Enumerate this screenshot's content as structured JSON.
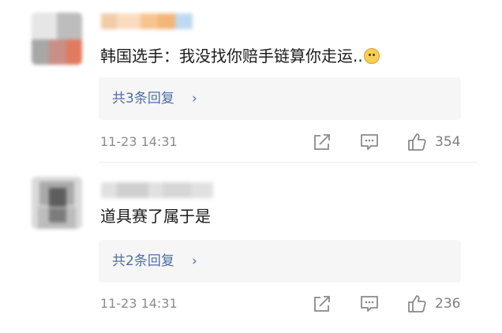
{
  "comments": [
    {
      "text": "韩国选手：我没找你赔手链算你走运..",
      "emoji": "smirk-cat-emoji",
      "replies_label": "共3条回复",
      "chevron": "›",
      "time": "11-23 14:31",
      "likes": "354"
    },
    {
      "text": "道具赛了属于是",
      "replies_label": "共2条回复",
      "chevron": "›",
      "time": "11-23 14:31",
      "likes": "236"
    }
  ],
  "colors": {
    "link": "#4f6ea6",
    "meta": "#8c8c8c",
    "reply_bg": "#f6f6f6"
  }
}
